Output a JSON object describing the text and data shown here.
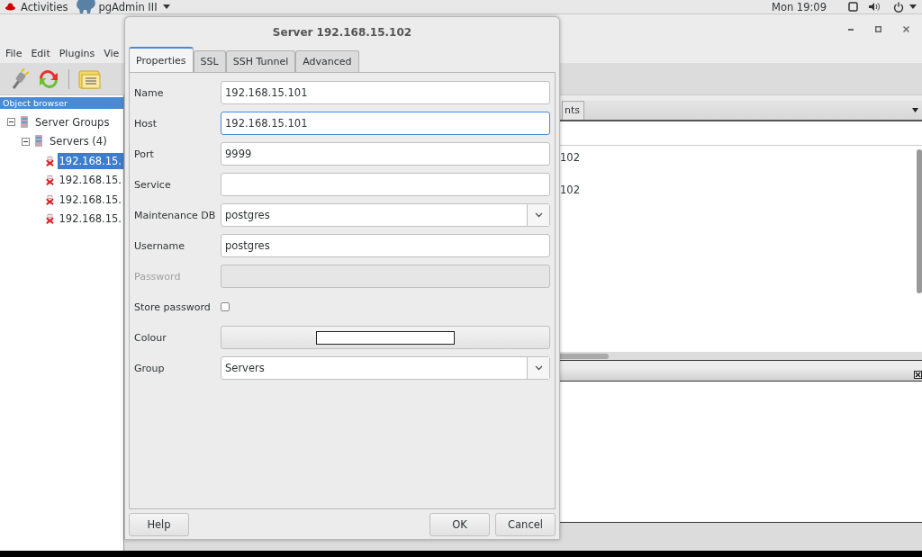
{
  "top_bar": {
    "activities": "Activities",
    "app_menu": "pgAdmin III",
    "clock": "Mon 19:09"
  },
  "main_window": {
    "menu": [
      "File",
      "Edit",
      "Plugins",
      "Vie"
    ],
    "object_browser": {
      "title": "Object browser",
      "tree": [
        {
          "label": "Server Groups",
          "kind": "group",
          "expanded": true,
          "selected": false,
          "children": [
            {
              "label": "Servers (4)",
              "kind": "group",
              "expanded": true,
              "selected": false,
              "children": [
                {
                  "label": "192.168.15.",
                  "kind": "server",
                  "selected": true
                },
                {
                  "label": "192.168.15.",
                  "kind": "server",
                  "selected": false
                },
                {
                  "label": "192.168.15.",
                  "kind": "server",
                  "selected": false
                },
                {
                  "label": "192.168.15.",
                  "kind": "server",
                  "selected": false
                }
              ]
            }
          ]
        }
      ]
    },
    "detail_tab": "nts",
    "detail_lines": [
      "102",
      "102"
    ]
  },
  "dialog": {
    "title": "Server 192.168.15.102",
    "tabs": [
      {
        "label": "Properties",
        "selected": true
      },
      {
        "label": "SSL",
        "selected": false
      },
      {
        "label": "SSH Tunnel",
        "selected": false
      },
      {
        "label": "Advanced",
        "selected": false
      }
    ],
    "fields": [
      {
        "kind": "text",
        "label": "Name",
        "value": "192.168.15.101",
        "focused": false,
        "disabled": false
      },
      {
        "kind": "text",
        "label": "Host",
        "value": "192.168.15.101",
        "focused": true,
        "disabled": false
      },
      {
        "kind": "text",
        "label": "Port",
        "value": "9999",
        "focused": false,
        "disabled": false
      },
      {
        "kind": "text",
        "label": "Service",
        "focused": false,
        "disabled": false
      },
      {
        "kind": "combo",
        "label": "Maintenance DB",
        "value": "postgres"
      },
      {
        "kind": "text",
        "label": "Username",
        "value": "postgres",
        "focused": false,
        "disabled": false
      },
      {
        "kind": "text",
        "label": "Password",
        "focused": false,
        "disabled": true
      },
      {
        "kind": "checkbox",
        "label": "Store password",
        "checked": false
      },
      {
        "kind": "colour",
        "label": "Colour",
        "color": "#ffffff"
      },
      {
        "kind": "combo",
        "label": "Group",
        "value": "Servers"
      }
    ],
    "left_buttons": [
      "Help"
    ],
    "right_buttons": [
      "OK",
      "Cancel"
    ]
  }
}
